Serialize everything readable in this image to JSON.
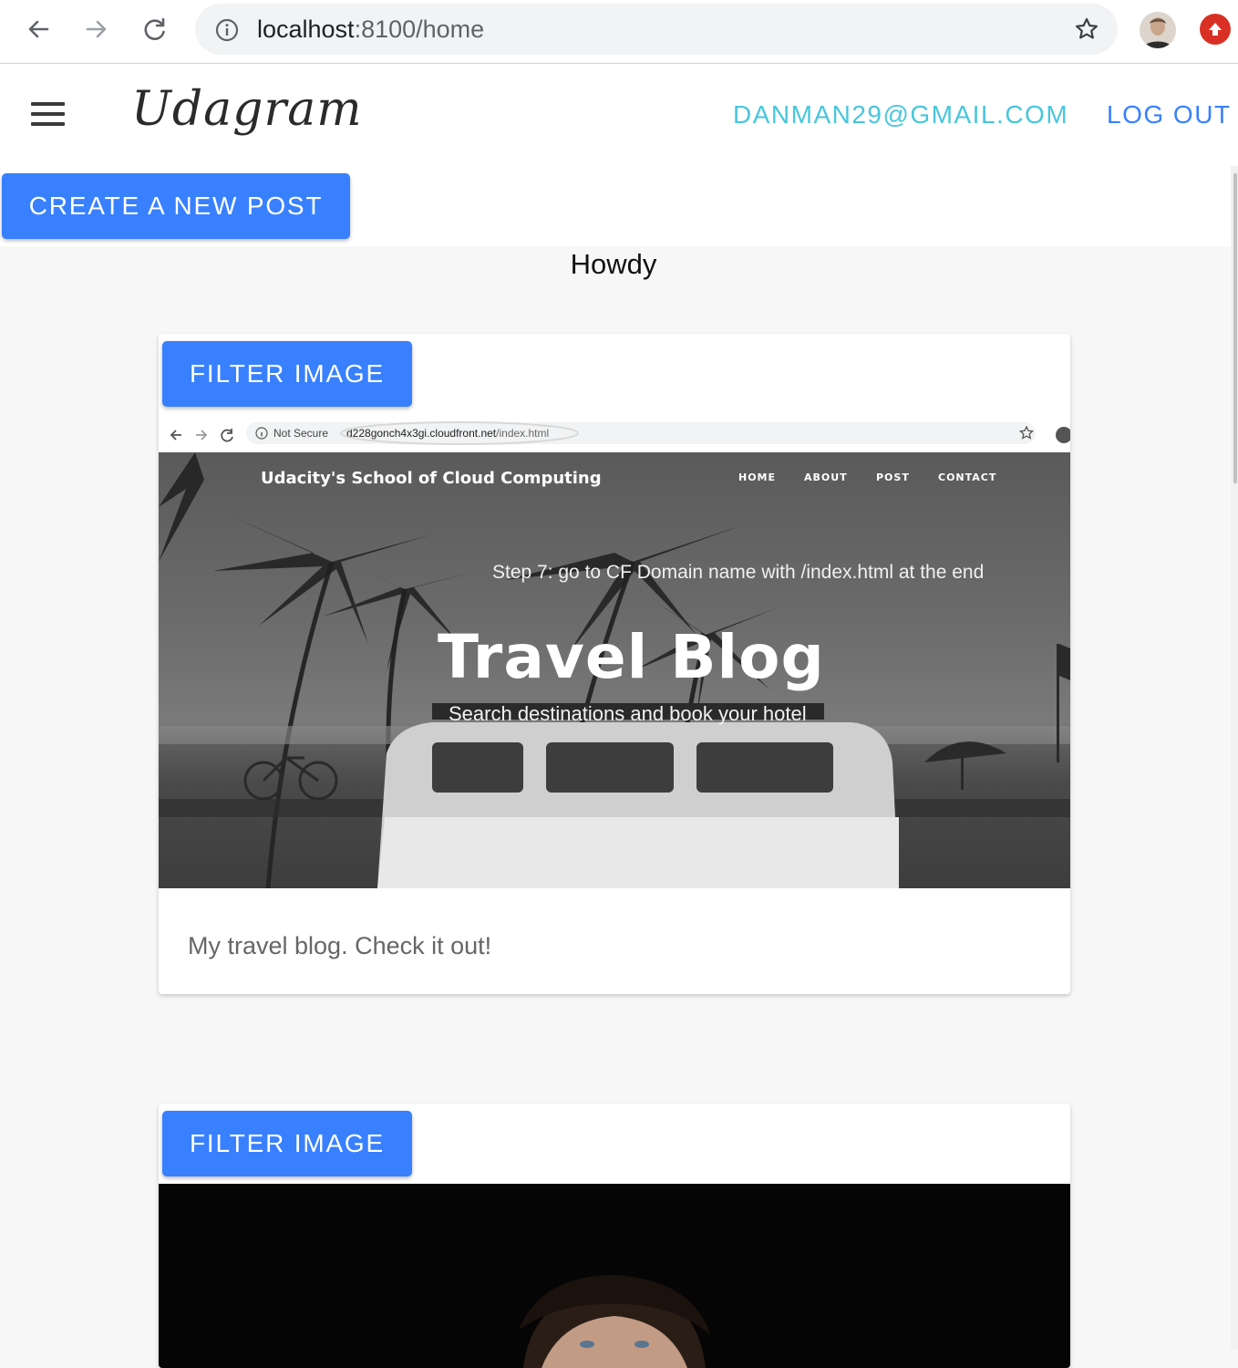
{
  "browser": {
    "url_host": "localhost",
    "url_rest": ":8100/home"
  },
  "header": {
    "brand": "Udagram",
    "user_email": "DANMAN29@GMAIL.COM",
    "logout_label": "LOG OUT"
  },
  "toolbar": {
    "create_label": "CREATE A NEW POST"
  },
  "greeting": "Howdy",
  "feed": [
    {
      "filter_label": "FILTER IMAGE",
      "caption": "My travel blog. Check it out!",
      "screenshot": {
        "not_secure": "Not Secure",
        "url_host": "d228gonch4x3gi.cloudfront.net",
        "url_path": "/index.html",
        "site_name": "Udacity's School of Cloud Computing",
        "nav": [
          "HOME",
          "ABOUT",
          "POST",
          "CONTACT"
        ],
        "step_note": "Step 7: go to CF Domain name with /index.html at the end",
        "title": "Travel Blog",
        "subtitle": "Search destinations and book your hotel"
      }
    },
    {
      "filter_label": "FILTER IMAGE"
    }
  ],
  "colors": {
    "primary": "#3880ff",
    "secondary": "#48c6dc"
  }
}
